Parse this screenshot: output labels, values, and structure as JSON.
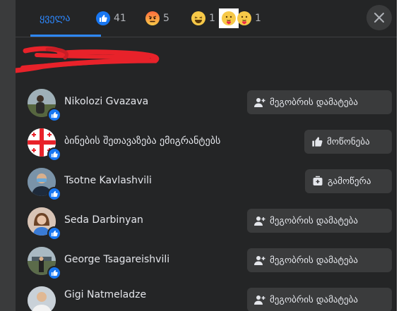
{
  "tabs": [
    {
      "label": "ყველა"
    },
    {
      "count": "41",
      "icon": "like-icon"
    },
    {
      "count": "5",
      "icon": "angry-icon"
    },
    {
      "count": "1",
      "icon": "haha-icon"
    },
    {
      "count": "1",
      "icon": "care-icon"
    }
  ],
  "close_label": "",
  "people": [
    {
      "name": "Nikolozi Gvazava",
      "action": "მეგობრის დამატება",
      "action_icon": "add-friend-icon",
      "avatar_color": "#6f7e66"
    },
    {
      "name": "ბინების შეთავაზება ემიგრანტებს",
      "action": "მოწონება",
      "action_icon": "thumbs-up-icon",
      "avatar_color": "#ffffff"
    },
    {
      "name": "Tsotne Kavlashvili",
      "action": "გამოწერა",
      "action_icon": "follow-icon",
      "avatar_color": "#4a6b8a"
    },
    {
      "name": "Seda Darbinyan",
      "action": "მეგობრის დამატება",
      "action_icon": "add-friend-icon",
      "avatar_color": "#c9a48a"
    },
    {
      "name": "George Tsagareishvili",
      "action": "მეგობრის დამატება",
      "action_icon": "add-friend-icon",
      "avatar_color": "#7b8b92"
    },
    {
      "name": "Gigi Natmeladze",
      "action": "მეგობრის დამატება",
      "action_icon": "add-friend-icon",
      "avatar_color": "#9aa2ab"
    }
  ],
  "colors": {
    "accent": "#2d88ff",
    "panel": "#242526",
    "button": "#3a3b3c",
    "redaction": "#e8222a"
  }
}
